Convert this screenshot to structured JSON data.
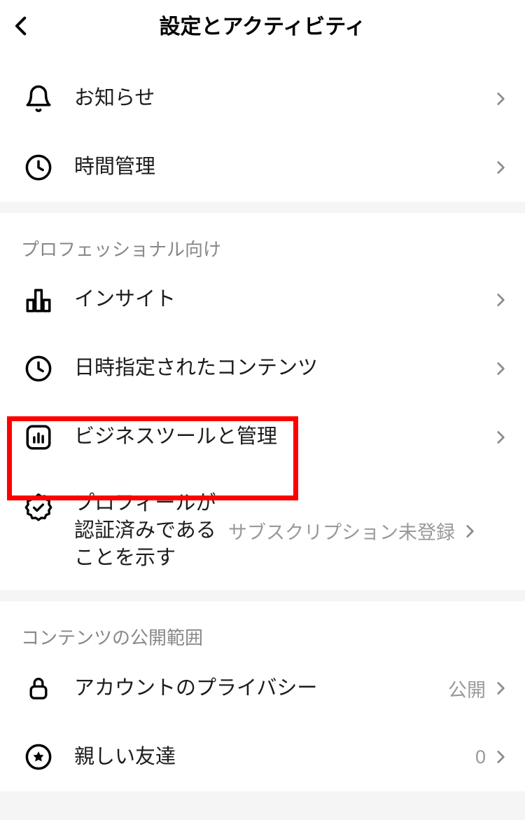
{
  "header": {
    "title": "設定とアクティビティ"
  },
  "section_top_items": [
    {
      "icon": "bell",
      "label": "お知らせ"
    },
    {
      "icon": "clock",
      "label": "時間管理"
    }
  ],
  "section_pro": {
    "title": "プロフェッショナル向け",
    "items": [
      {
        "icon": "bars",
        "label": "インサイト"
      },
      {
        "icon": "clock",
        "label": "日時指定されたコンテンツ"
      },
      {
        "icon": "dashboard",
        "label": "ビジネスツールと管理"
      },
      {
        "icon": "verified",
        "label": "プロフィールが認証済みであることを示す",
        "value": "サブスクリプション未登録"
      }
    ]
  },
  "section_visibility": {
    "title": "コンテンツの公開範囲",
    "items": [
      {
        "icon": "lock",
        "label": "アカウントのプライバシー",
        "value": "公開"
      },
      {
        "icon": "star",
        "label": "親しい友達",
        "value": "0"
      }
    ]
  }
}
